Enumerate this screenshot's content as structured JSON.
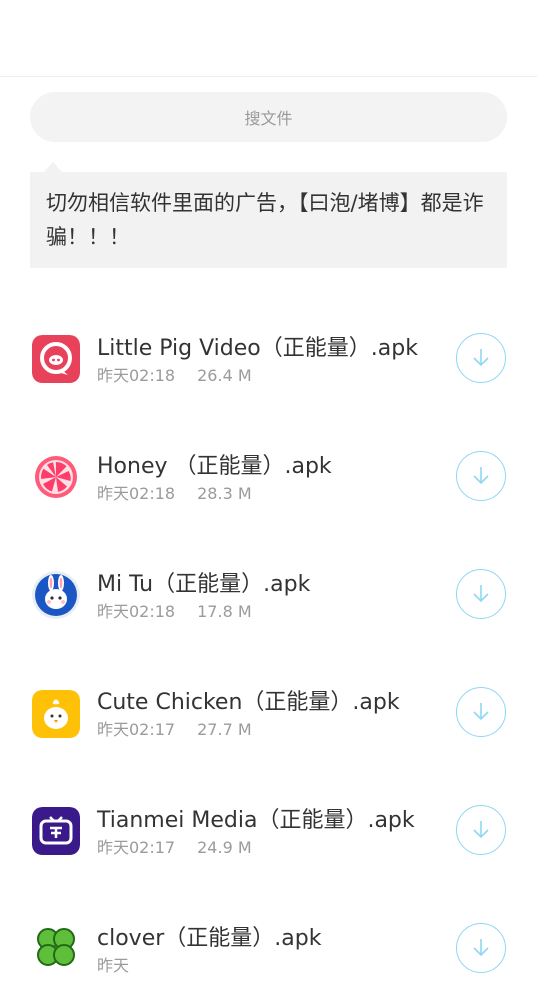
{
  "search": {
    "placeholder": "搜文件"
  },
  "notice": {
    "text": "切勿相信软件里面的广告，【曰泡/堵博】都是诈骗！！！"
  },
  "files": [
    {
      "name": "Little Pig Video（正能量）.apk",
      "time": "昨天02:18",
      "size": "26.4 M",
      "icon": "pig-icon"
    },
    {
      "name": "Honey （正能量）.apk",
      "time": "昨天02:18",
      "size": "28.3 M",
      "icon": "grapefruit-icon"
    },
    {
      "name": "Mi Tu（正能量）.apk",
      "time": "昨天02:18",
      "size": "17.8 M",
      "icon": "rabbit-icon"
    },
    {
      "name": "Cute Chicken（正能量）.apk",
      "time": "昨天02:17",
      "size": "27.7 M",
      "icon": "chick-icon"
    },
    {
      "name": "Tianmei Media（正能量）.apk",
      "time": "昨天02:17",
      "size": "24.9 M",
      "icon": "tv-icon"
    },
    {
      "name": "clover（正能量）.apk",
      "time": "昨天",
      "size": "",
      "icon": "clover-icon"
    }
  ],
  "colors": {
    "download_ring": "#8fd7f3",
    "search_bg": "#f3f3f3",
    "notice_bg": "#f2f2f2"
  }
}
